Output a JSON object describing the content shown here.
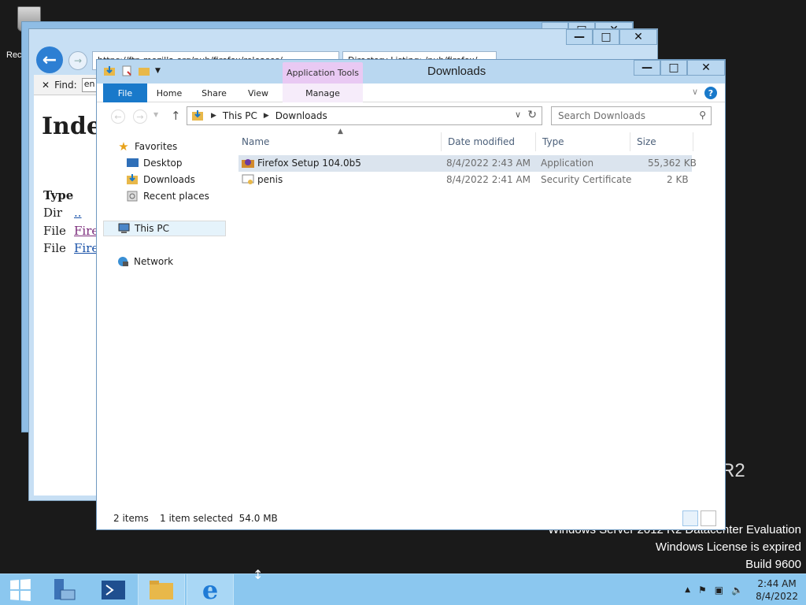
{
  "desktop": {
    "recycle_label": "Rec",
    "watermark": [
      "Windows Server 2012 R2 Datacenter Evaluation",
      "Windows License is expired",
      "Build 9600"
    ],
    "r2": "R2"
  },
  "ie_window": {
    "tabs": [
      "https://ftp.mozilla.org/pub/firefox/releases/",
      "Directory Listing: /pub/firefox/"
    ],
    "find_label": "Find:",
    "find_value": "en",
    "page_heading": "Index",
    "rows": [
      {
        "type": "Type",
        "link": ""
      },
      {
        "type": "Dir",
        "link": ".."
      },
      {
        "type": "File",
        "link": "Firef"
      },
      {
        "type": "File",
        "link": "Firef"
      }
    ]
  },
  "explorer": {
    "title": "Downloads",
    "context_tab_group": "Application Tools",
    "ribbon_tabs": [
      "File",
      "Home",
      "Share",
      "View",
      "Manage"
    ],
    "address": {
      "segments": [
        "This PC",
        "Downloads"
      ]
    },
    "search_placeholder": "Search Downloads",
    "nav": {
      "favorites": "Favorites",
      "items": [
        "Desktop",
        "Downloads",
        "Recent places"
      ],
      "this_pc": "This PC",
      "network": "Network"
    },
    "columns": [
      "Name",
      "Date modified",
      "Type",
      "Size"
    ],
    "files": [
      {
        "name": "Firefox Setup 104.0b5",
        "date": "8/4/2022 2:43 AM",
        "type": "Application",
        "size": "55,362 KB",
        "selected": true
      },
      {
        "name": "penis",
        "date": "8/4/2022 2:41 AM",
        "type": "Security Certificate",
        "size": "2 KB",
        "selected": false
      }
    ],
    "status": {
      "count": "2 items",
      "selection": "1 item selected  54.0 MB"
    }
  },
  "taskbar": {
    "time": "2:44 AM",
    "date": "8/4/2022"
  },
  "colors": {
    "accent": "#1979ca",
    "taskbar": "#8bc7ef",
    "titlebar": "#b9d7f0",
    "context_tab": "#e9c9f3"
  }
}
